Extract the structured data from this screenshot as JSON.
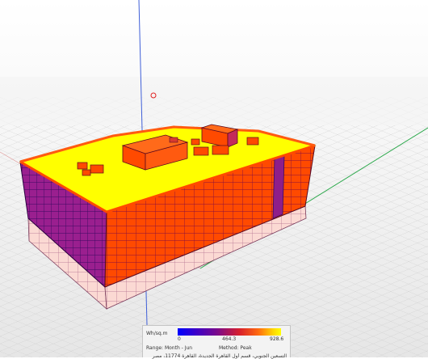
{
  "legend": {
    "unit": "Wh/sq.m",
    "min": "0",
    "mid": "464.3",
    "max": "928.6",
    "range": "Range: Month - Jun",
    "method": "Method: Peak",
    "address": "التسعين الجنوبي، قسم أول القاهرة الجديدة، القاهرة 11774، مصر"
  },
  "colors": {
    "roof": "#ffff00",
    "wall_high": "#ff4a00",
    "wall_mid": "#a0208a",
    "wall_low": "#fcd7d2",
    "axis_green": "#2aa84a",
    "axis_blue": "#3f5fd8"
  }
}
